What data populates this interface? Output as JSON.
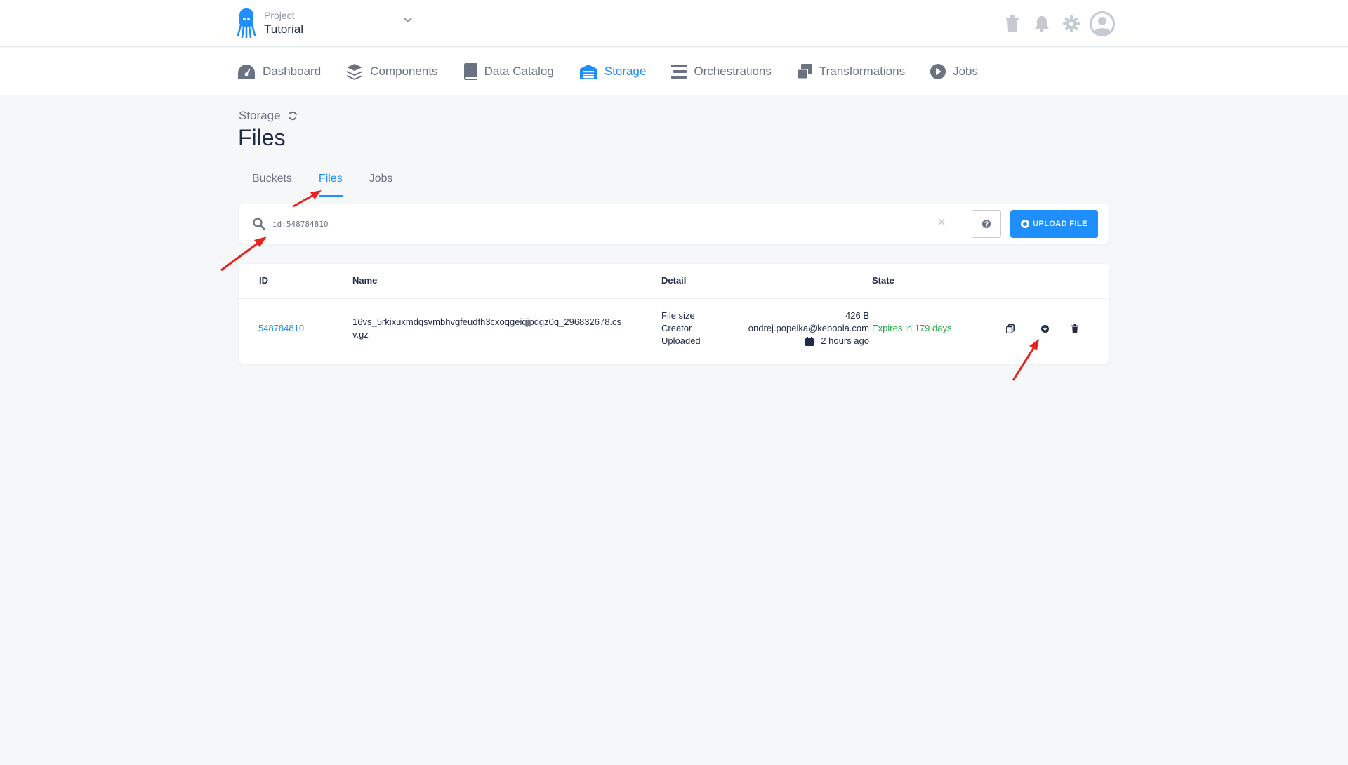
{
  "header": {
    "project_label": "Project",
    "project_name": "Tutorial"
  },
  "nav": {
    "items": [
      {
        "label": "Dashboard",
        "icon": "dashboard-icon"
      },
      {
        "label": "Components",
        "icon": "layers-icon"
      },
      {
        "label": "Data Catalog",
        "icon": "book-icon"
      },
      {
        "label": "Storage",
        "icon": "storage-icon",
        "active": true
      },
      {
        "label": "Orchestrations",
        "icon": "bars-icon"
      },
      {
        "label": "Transformations",
        "icon": "windows-icon"
      },
      {
        "label": "Jobs",
        "icon": "play-icon"
      }
    ]
  },
  "breadcrumb": "Storage",
  "page_title": "Files",
  "tabs": [
    {
      "label": "Buckets"
    },
    {
      "label": "Files",
      "active": true
    },
    {
      "label": "Jobs"
    }
  ],
  "search": {
    "value": "id:548784810",
    "upload_label": "UPLOAD FILE"
  },
  "table": {
    "headers": [
      "ID",
      "Name",
      "Detail",
      "State"
    ],
    "row": {
      "id": "548784810",
      "name_line1": "16vs_5rkixuxmdqsvmbhvgfeudfh3cxoqgeiqjpdgz0q_296832678.cs",
      "name_line2": "v.gz",
      "detail_labels": [
        "File size",
        "Creator",
        "Uploaded"
      ],
      "file_size": "426 B",
      "creator": "ondrej.popelka@keboola.com",
      "uploaded": "2 hours ago",
      "state": "Expires in 179 days"
    }
  },
  "colors": {
    "accent": "#1f8fff",
    "success": "#27a845",
    "annotation": "#e5231f"
  }
}
